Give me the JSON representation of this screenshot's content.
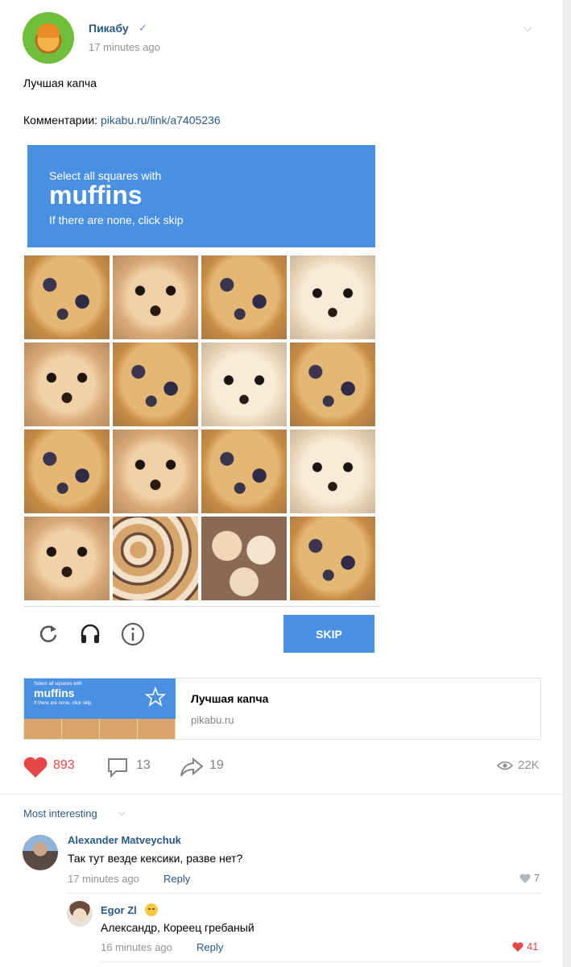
{
  "post": {
    "publisher": "Пикабу",
    "verified_icon": "✓",
    "time": "17 minutes ago",
    "menu_icon": "⌵",
    "title": "Лучшая капча",
    "comments_prefix": "Комментарии: ",
    "comments_link": "pikabu.ru/link/a7405236"
  },
  "captcha": {
    "line1": "Select all squares with",
    "line2": "muffins",
    "line3": "If there are none, click skip",
    "tiles": [
      "muffin",
      "dog",
      "muffin",
      "dog white",
      "dog",
      "muffin",
      "dog white",
      "muffin",
      "muffin",
      "dog",
      "muffin",
      "dog white",
      "dog",
      "many",
      "dogs",
      "muffin"
    ],
    "skip_label": "SKIP",
    "accent": "#4a90e2"
  },
  "link_card": {
    "thumb_line1": "Select all squares with",
    "thumb_line2": "muffins",
    "thumb_line3": "If there are none, click skip",
    "title": "Лучшая капча",
    "domain": "pikabu.ru"
  },
  "actions": {
    "likes": "893",
    "comments": "13",
    "shares": "19",
    "views": "22K",
    "like_color": "#e64646"
  },
  "comments": {
    "sort_label": "Most interesting",
    "sort_chevron": "⌵",
    "items": [
      {
        "author": "Alexander Matveychuk",
        "text": "Так тут везде кексики, разве нет?",
        "time": "17 minutes ago",
        "reply": "Reply",
        "likes": "7"
      },
      {
        "author": "Egor Zl",
        "text": "Александр, Кореец гребаный",
        "time": "16 minutes ago",
        "reply": "Reply",
        "likes": "41"
      }
    ]
  }
}
